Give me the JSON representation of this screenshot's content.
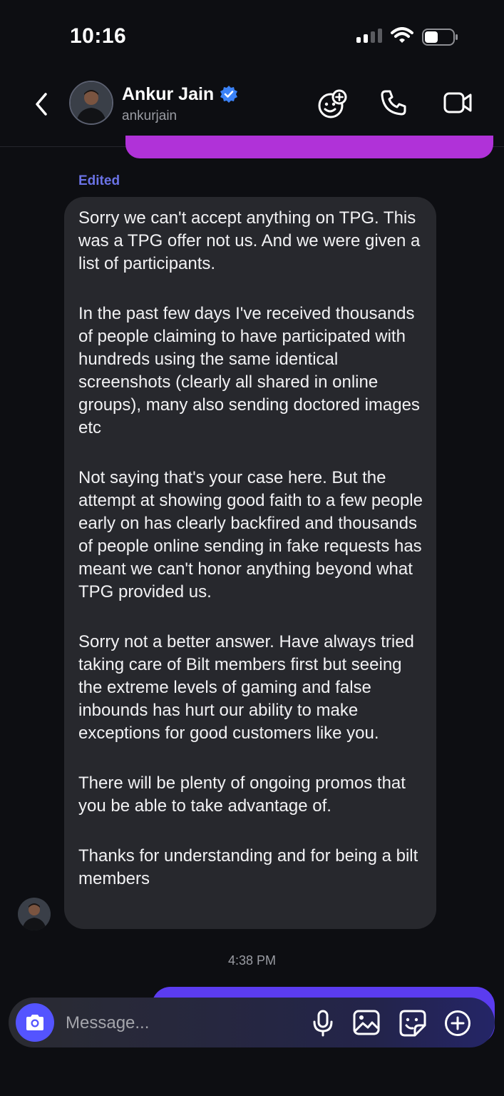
{
  "status_bar": {
    "time": "10:16"
  },
  "header": {
    "name": "Ankur Jain",
    "handle": "ankurjain",
    "icons": [
      "back-chevron-icon",
      "verified-badge-icon",
      "sticker-add-icon",
      "phone-icon",
      "video-camera-icon"
    ]
  },
  "chat": {
    "edited_label": "Edited",
    "message_paragraphs": [
      "Sorry we can't accept anything on TPG. This was a TPG offer not us. And we were given a list of participants.",
      "In the past few days I've received thousands of people claiming to have participated with hundreds using the same identical screenshots (clearly all shared in online groups), many also sending doctored images etc",
      "Not saying that's your case here. But the attempt at showing good faith to a few people early on has clearly backfired and thousands of people online sending in fake requests has meant we can't honor anything beyond what TPG provided us.",
      "Sorry not a better answer. Have always tried taking care of Bilt members first but seeing the extreme levels of gaming and false inbounds has hurt our ability to make exceptions for good customers like you.",
      "There will be plenty of ongoing promos that you be able to take advantage of.",
      "Thanks for understanding and for being a bilt members"
    ],
    "timestamp": "4:38 PM"
  },
  "composer": {
    "placeholder": "Message...",
    "icons": [
      "camera-icon",
      "microphone-icon",
      "image-icon",
      "sticker-icon",
      "plus-circle-icon"
    ]
  },
  "colors": {
    "background": "#0d0e12",
    "received_bubble": "#27282d",
    "sent_bubble_purple": "#b032d8",
    "sent_bubble_blue": "#5b3cf0",
    "accent": "#5454ff",
    "edited": "#6b73e6",
    "verified": "#3b82f6"
  }
}
